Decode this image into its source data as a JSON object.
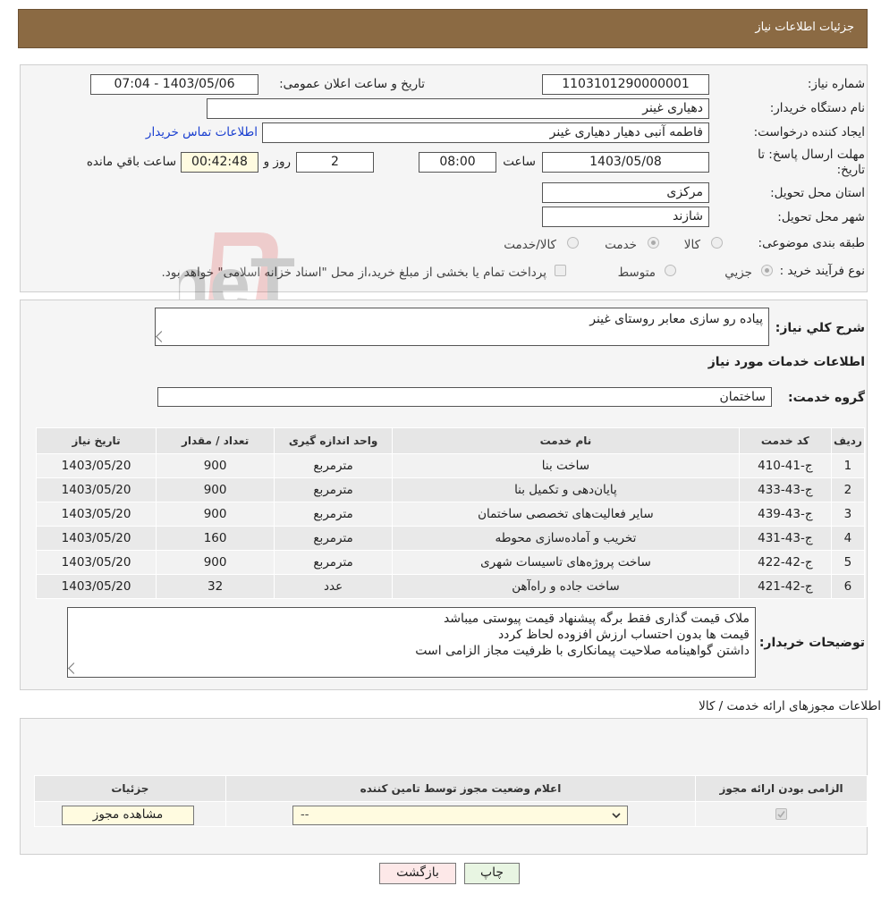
{
  "header": {
    "title": "جزئیات اطلاعات نیاز"
  },
  "info": {
    "need_number_label": "شماره نیاز:",
    "need_number": "1103101290000001",
    "announce_label": "تاریخ و ساعت اعلان عمومی:",
    "announce_value": "1403/05/06 - 07:04",
    "buyer_label": "نام دستگاه خریدار:",
    "buyer_value": "دهیاری غینر",
    "requester_label": "ایجاد کننده درخواست:",
    "requester_value": "فاطمه آنبی دهیار دهیاری غینر",
    "contact_link": "اطلاعات تماس خریدار",
    "deadline_label": "مهلت ارسال پاسخ: تا تاریخ:",
    "deadline_date": "1403/05/08",
    "time_label": "ساعت",
    "deadline_time": "08:00",
    "days_value": "2",
    "days_label": "روز و",
    "remaining_value": "00:42:48",
    "remaining_label": "ساعت باقي مانده",
    "province_label": "استان محل تحویل:",
    "province_value": "مرکزی",
    "city_label": "شهر محل تحویل:",
    "city_value": "شازند",
    "category_label": "طبقه بندی موضوعی:",
    "category_options": [
      "کالا",
      "خدمت",
      "کالا/خدمت"
    ],
    "process_label": "نوع فرآیند خرید :",
    "process_options": [
      "جزیي",
      "متوسط"
    ],
    "payment_note": "پرداخت تمام یا بخشی از مبلغ خرید،از محل \"اسناد خزانه اسلامی\" خواهد بود."
  },
  "services": {
    "summary_label": "شرح کلي نياز:",
    "summary_value": "پیاده رو سازی معابر روستای غینر",
    "section_title": "اطلاعات خدمات مورد نیاز",
    "group_label": "گروه خدمت:",
    "group_value": "ساختمان",
    "columns": [
      "ردیف",
      "کد خدمت",
      "نام خدمت",
      "واحد اندازه گیری",
      "تعداد / مقدار",
      "تاریخ نیاز"
    ],
    "rows": [
      [
        "1",
        "ج-41-410",
        "ساخت بنا",
        "مترمربع",
        "900",
        "1403/05/20"
      ],
      [
        "2",
        "ج-43-433",
        "پایان‌دهی و تکمیل بنا",
        "مترمربع",
        "900",
        "1403/05/20"
      ],
      [
        "3",
        "ج-43-439",
        "سایر فعالیت‌های تخصصی ساختمان",
        "مترمربع",
        "900",
        "1403/05/20"
      ],
      [
        "4",
        "ج-43-431",
        "تخریب و آماده‌سازی محوطه",
        "مترمربع",
        "160",
        "1403/05/20"
      ],
      [
        "5",
        "ج-42-422",
        "ساخت پروژه‌های تاسیسات شهری",
        "مترمربع",
        "900",
        "1403/05/20"
      ],
      [
        "6",
        "ج-42-421",
        "ساخت جاده و راه‌آهن",
        "عدد",
        "32",
        "1403/05/20"
      ]
    ],
    "buyer_notes_label": "توضیحات خریدار:",
    "buyer_notes": [
      "ملاک قیمت گذاری فقط برگه پیشنهاد قیمت پیوستی میباشد",
      "قیمت ها بدون احتساب ارزش افزوده لحاظ کردد",
      "داشتن گواهینامه صلاحیت پیمانکاری با ظرفیت مجاز الزامی است"
    ]
  },
  "permits": {
    "section_title": "اطلاعات مجوزهای ارائه خدمت / کالا",
    "columns": [
      "الزامی بودن ارائه مجوز",
      "اعلام وضعیت مجوز توسط تامین کننده",
      "جزئیات"
    ],
    "select_value": "--",
    "view_button": "مشاهده مجوز"
  },
  "footer": {
    "print_button": "چاپ",
    "back_button": "بازگشت"
  },
  "watermark": {
    "text": "AriaTender.neT"
  }
}
